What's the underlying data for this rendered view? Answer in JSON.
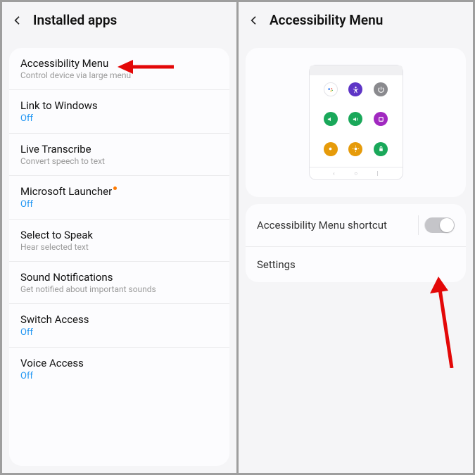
{
  "left": {
    "title": "Installed apps",
    "items": [
      {
        "title": "Accessibility Menu",
        "sub": "Control device via large menu"
      },
      {
        "title": "Link to Windows",
        "off": "Off"
      },
      {
        "title": "Live Transcribe",
        "sub": "Convert speech to text"
      },
      {
        "title": "Microsoft Launcher",
        "off": "Off",
        "dot": true
      },
      {
        "title": "Select to Speak",
        "sub": "Hear selected text"
      },
      {
        "title": "Sound Notifications",
        "sub": "Get notified about important sounds"
      },
      {
        "title": "Switch Access",
        "off": "Off"
      },
      {
        "title": "Voice Access",
        "off": "Off"
      }
    ]
  },
  "right": {
    "title": "Accessibility Menu",
    "shortcut_label": "Accessibility Menu shortcut",
    "settings_label": "Settings",
    "icon_colors": [
      "#ffffff",
      "#5e35c6",
      "#8a8a8e",
      "#1aa85a",
      "#1aa85a",
      "#a129c0",
      "#e69b0a",
      "#e69b0a",
      "#1aa85a"
    ]
  }
}
